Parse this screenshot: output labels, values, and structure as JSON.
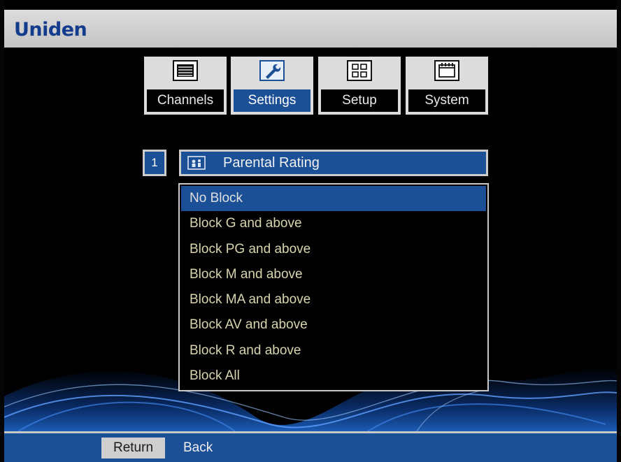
{
  "brand": "Uniden",
  "tabs": [
    {
      "label": "Channels",
      "icon": "list-icon",
      "active": false
    },
    {
      "label": "Settings",
      "icon": "wrench-icon",
      "active": true
    },
    {
      "label": "Setup",
      "icon": "grid-icon",
      "active": false
    },
    {
      "label": "System",
      "icon": "calendar-icon",
      "active": false
    }
  ],
  "menu": {
    "item_number": "1",
    "item_label": "Parental Rating",
    "item_icon": "parental-icon",
    "options": [
      "No Block",
      "Block G and above",
      "Block PG and above",
      "Block M and above",
      "Block MA and above",
      "Block AV and above",
      "Block R and above",
      "Block All"
    ],
    "selected_option": "No Block"
  },
  "footer": {
    "return_key": "Return",
    "back_label": "Back"
  },
  "colors": {
    "accent_blue": "#1b4f96",
    "brand_blue": "#143c8c",
    "option_text": "#d8d4b0"
  }
}
